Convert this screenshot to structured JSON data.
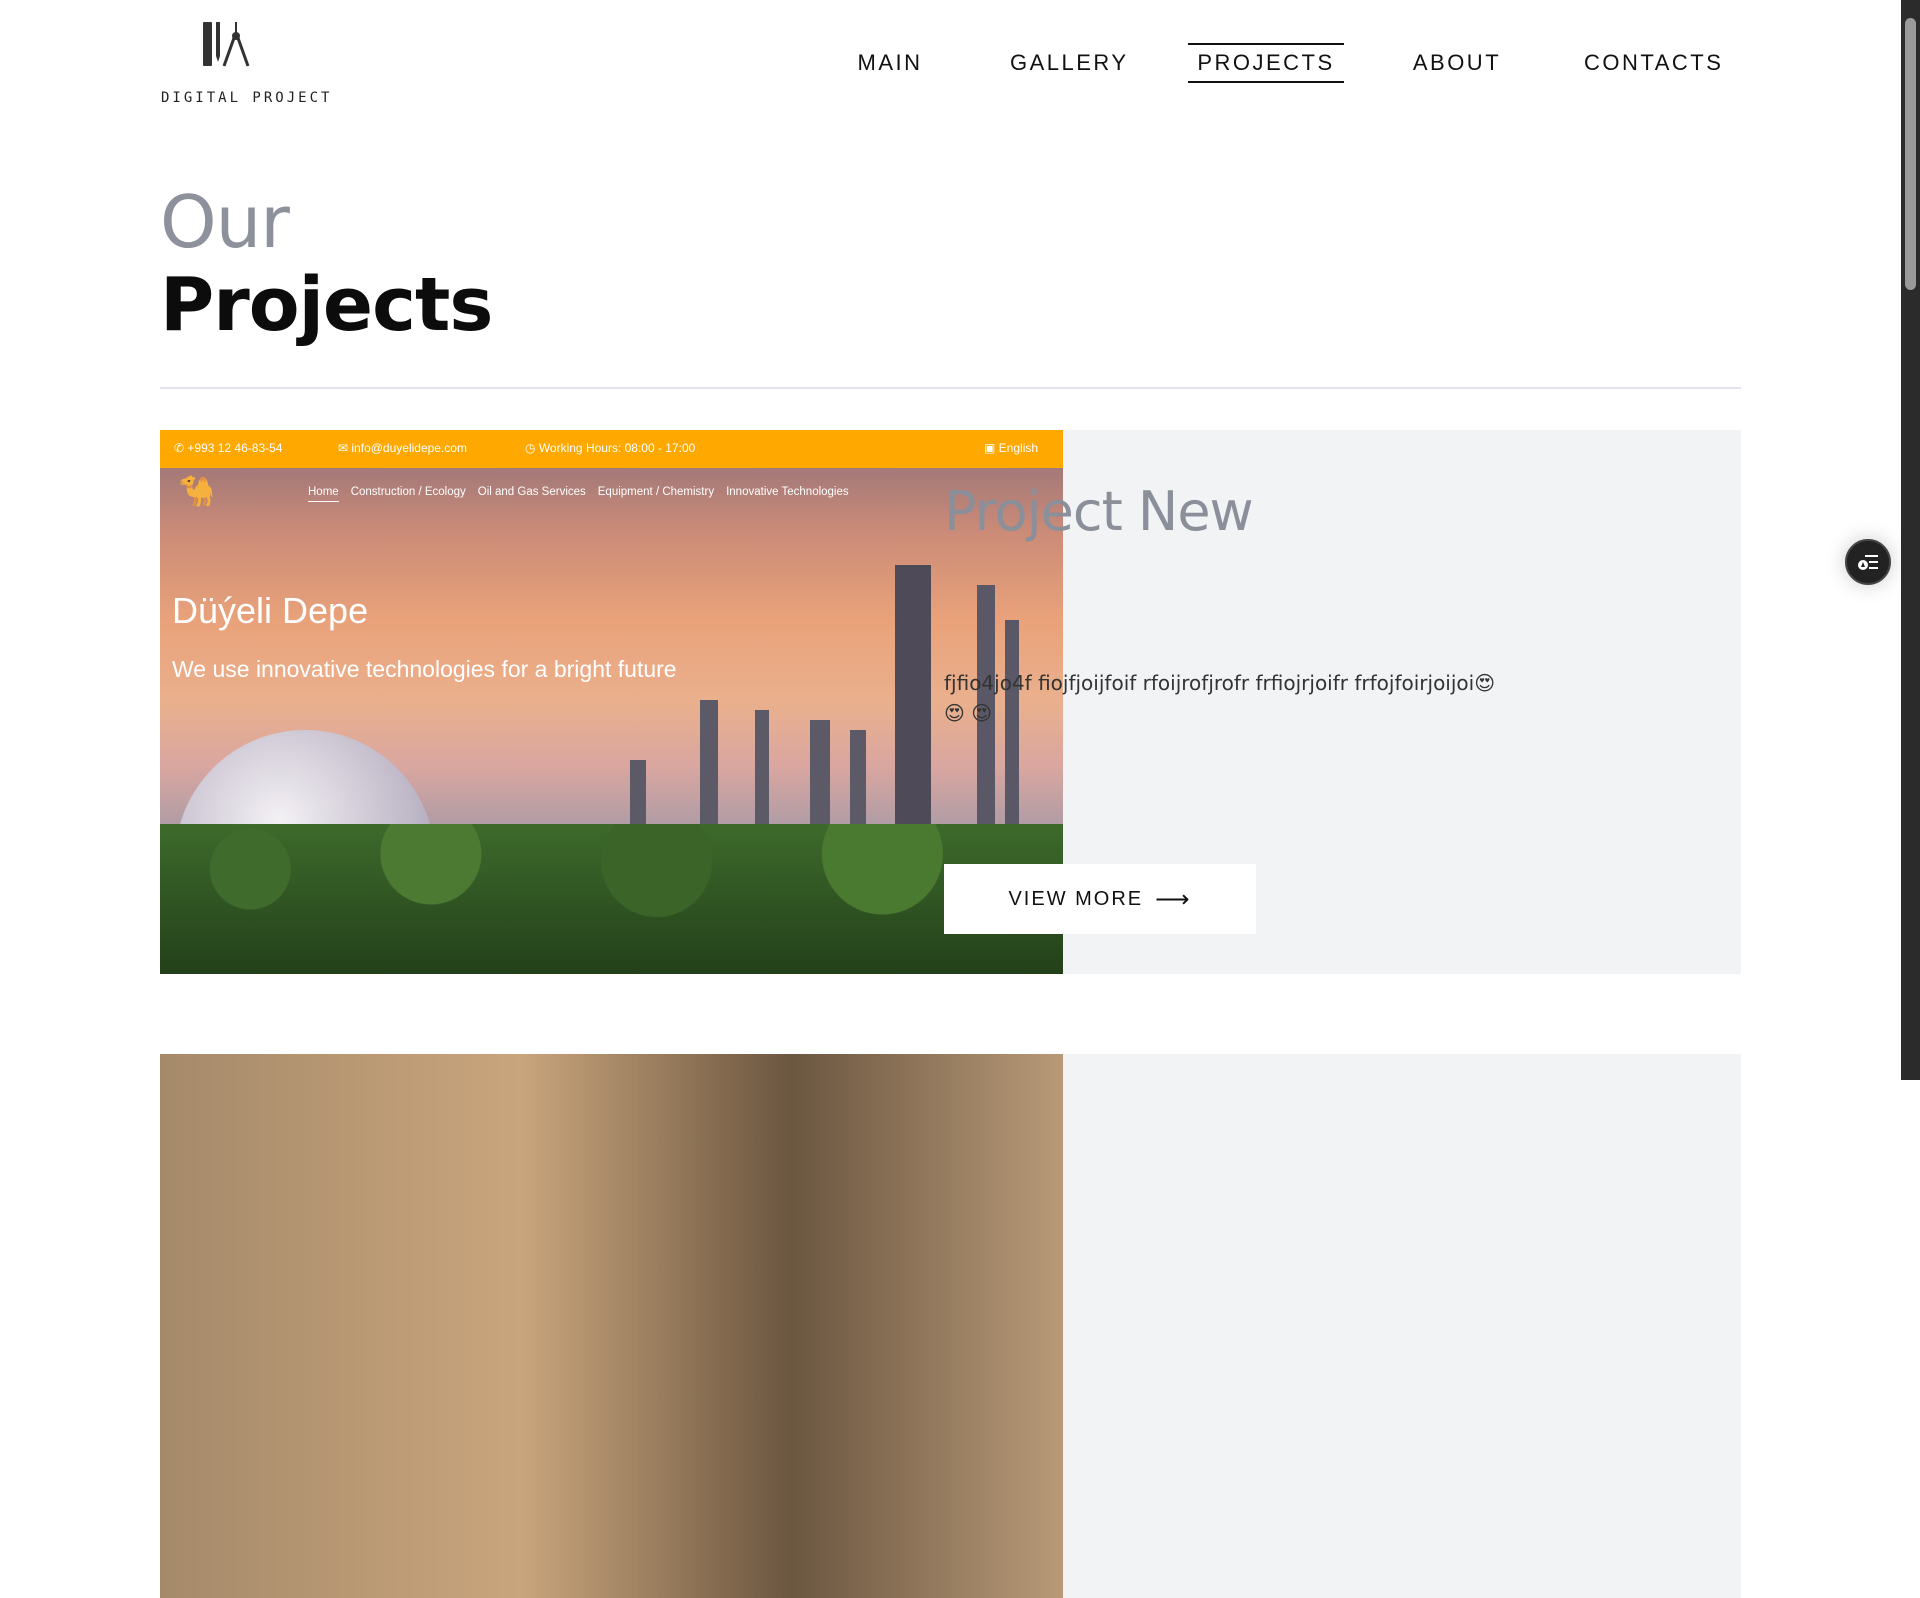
{
  "logo": {
    "text": "DIGITAL PROJECT"
  },
  "nav": [
    {
      "label": "MAIN"
    },
    {
      "label": "GALLERY"
    },
    {
      "label": "PROJECTS",
      "active": true
    },
    {
      "label": "ABOUT"
    },
    {
      "label": "CONTACTS"
    }
  ],
  "heading": {
    "line1": "Our",
    "line2": "Projects"
  },
  "projects": [
    {
      "title": "Project New",
      "description": "fjfio4jo4f fiojfjoijfoif rfoijrofjrofr frfiojrjoifr frfojfoirjoijoi😍 😍 😍",
      "button": "VIEW MORE",
      "screenshot": {
        "phone": "+993 12 46-83-54",
        "email": "info@duyelidepe.com",
        "hours": "Working Hours: 08:00 - 17:00",
        "language": "English",
        "accent": "#ffa800",
        "nav": [
          "Home",
          "Construction / Ecology",
          "Oil and Gas Services",
          "Equipment / Chemistry",
          "Innovative Technologies"
        ],
        "hero_title": "Düýeli Depe",
        "hero_subtitle": "We use innovative technologies for a bright future"
      }
    }
  ]
}
